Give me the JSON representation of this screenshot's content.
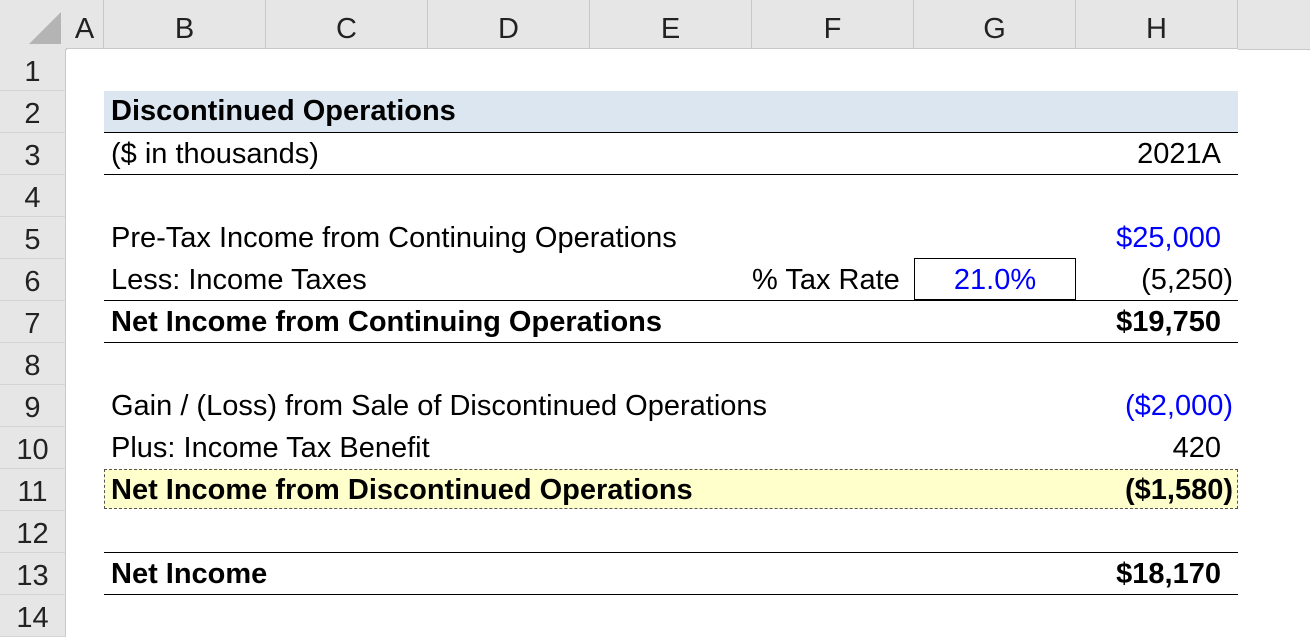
{
  "columns": [
    "A",
    "B",
    "C",
    "D",
    "E",
    "F",
    "G",
    "H"
  ],
  "rows": [
    "1",
    "2",
    "3",
    "4",
    "5",
    "6",
    "7",
    "8",
    "9",
    "10",
    "11",
    "12",
    "13",
    "14"
  ],
  "header": {
    "title": "Discontinued Operations",
    "units": "($ in thousands)",
    "year": "2021A"
  },
  "continuing": {
    "pretax_label": "Pre-Tax Income from Continuing Operations",
    "pretax_value": "$25,000",
    "taxes_label": "Less: Income Taxes",
    "tax_rate_label": "% Tax Rate",
    "tax_rate_value": "21.0%",
    "taxes_value": "(5,250)",
    "net_label": "Net Income from Continuing Operations",
    "net_value": "$19,750"
  },
  "discontinued": {
    "gain_label": "Gain / (Loss) from Sale of Discontinued Operations",
    "gain_value": "($2,000)",
    "benefit_label": "Plus: Income Tax Benefit",
    "benefit_value": "420",
    "net_label": "Net Income from Discontinued Operations",
    "net_value": "($1,580)"
  },
  "total": {
    "label": "Net Income",
    "value": "$18,170"
  },
  "colors": {
    "title_band": "#dce6f1",
    "highlight": "#ffffcc",
    "input_blue": "#0000ff",
    "header_gray": "#e6e6e6"
  }
}
